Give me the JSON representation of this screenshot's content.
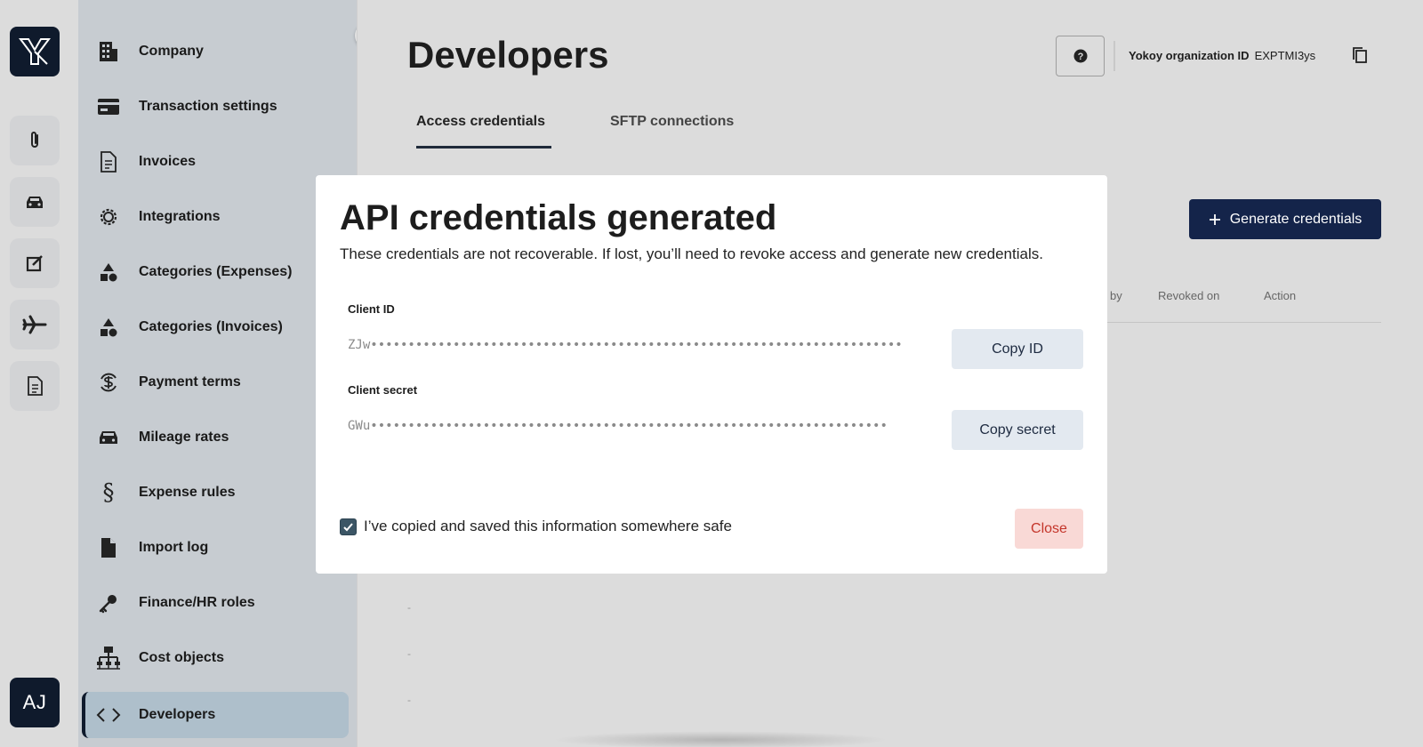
{
  "rail": {
    "avatar_initials": "AJ",
    "icons": [
      "paperclip-icon",
      "car-icon",
      "edit-icon",
      "airplane-icon",
      "document-icon"
    ]
  },
  "sidebar": {
    "items": [
      {
        "label": "Company",
        "icon": "building-icon"
      },
      {
        "label": "Transaction settings",
        "icon": "card-icon"
      },
      {
        "label": "Invoices",
        "icon": "document-icon"
      },
      {
        "label": "Integrations",
        "icon": "gear-icon"
      },
      {
        "label": "Categories (Expenses)",
        "icon": "shapes-icon"
      },
      {
        "label": "Categories (Invoices)",
        "icon": "shapes-icon"
      },
      {
        "label": "Payment terms",
        "icon": "dollar-cycle-icon"
      },
      {
        "label": "Mileage rates",
        "icon": "car-icon"
      },
      {
        "label": "Expense rules",
        "icon": "section-icon"
      },
      {
        "label": "Import log",
        "icon": "file-icon"
      },
      {
        "label": "Finance/HR roles",
        "icon": "key-icon"
      },
      {
        "label": "Cost objects",
        "icon": "hierarchy-icon"
      },
      {
        "label": "Developers",
        "icon": "code-icon",
        "active": true
      }
    ]
  },
  "header": {
    "title": "Developers",
    "org_label": "Yokoy organization ID",
    "org_id": "EXPTMI3ys"
  },
  "tabs": {
    "access": "Access credentials",
    "sftp": "SFTP connections"
  },
  "toolbar": {
    "generate_label": "Generate credentials"
  },
  "table": {
    "headers": [
      "by",
      "Revoked on",
      "Action"
    ]
  },
  "modal": {
    "title": "API credentials generated",
    "description": "These credentials are not recoverable. If lost, you’ll need to revoke access and generate new credentials.",
    "client_id_label": "Client ID",
    "client_id_value": "ZJw•••••••••••••••••••••••••••••••••••••••••••••••••••••••••••••••••••••••",
    "copy_id_label": "Copy ID",
    "client_secret_label": "Client secret",
    "client_secret_value": "GWu•••••••••••••••••••••••••••••••••••••••••••••••••••••••••••••••••••••",
    "copy_secret_label": "Copy secret",
    "confirm_label": "I’ve copied and saved this information somewhere safe",
    "confirm_checked": true,
    "close_label": "Close"
  },
  "colors": {
    "brand_dark": "#0f1a2c",
    "primary_button": "#14244a",
    "danger_text": "#c4352a",
    "danger_bg": "#f9d9d6"
  }
}
